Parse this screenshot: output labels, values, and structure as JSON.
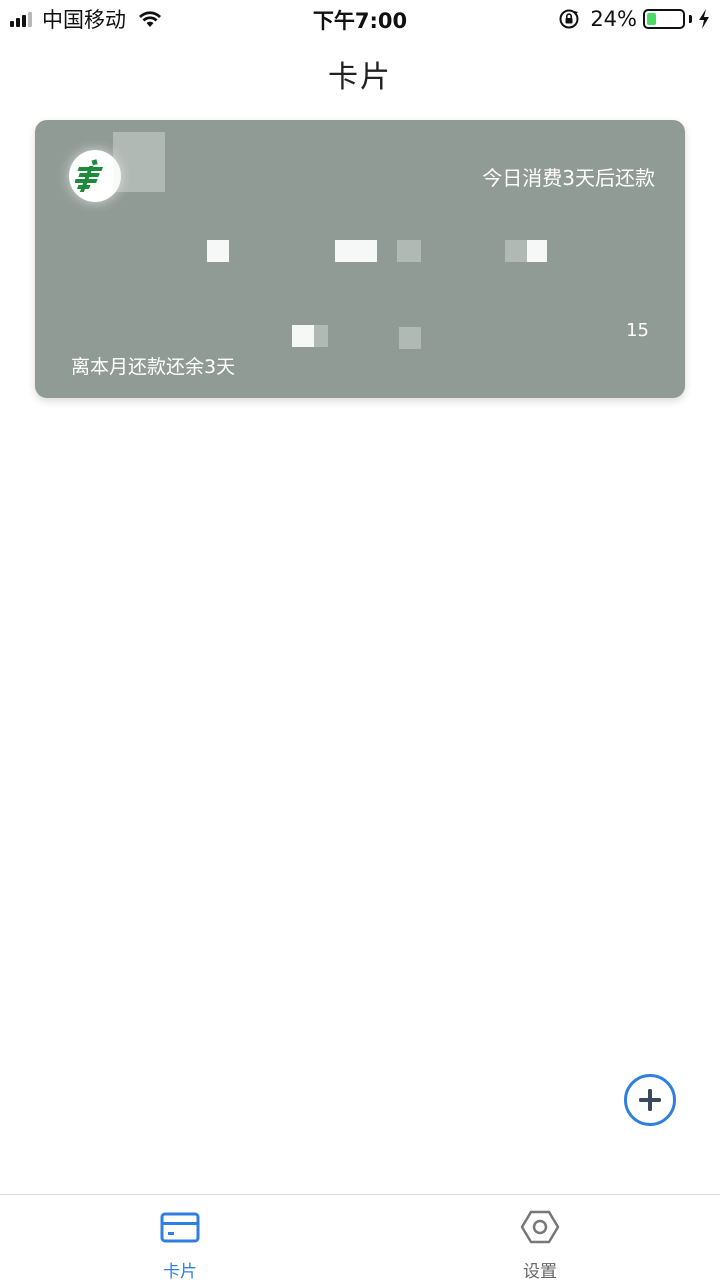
{
  "status_bar": {
    "carrier": "中国移动",
    "time": "下午7:00",
    "battery_percent": "24%",
    "battery_level": 0.24
  },
  "header": {
    "title": "卡片"
  },
  "card": {
    "status_text": "今日消费3天后还款",
    "day_value": "15",
    "bottom_text": "离本月还款还余3天",
    "background_color": "#919b95"
  },
  "fab": {
    "icon": "plus-icon",
    "color": "#2f7fe0"
  },
  "tab_bar": {
    "tabs": [
      {
        "label": "卡片",
        "icon": "card-icon",
        "active": true
      },
      {
        "label": "设置",
        "icon": "settings-hexagon-icon",
        "active": false
      }
    ],
    "active_color": "#2f7fe0"
  }
}
